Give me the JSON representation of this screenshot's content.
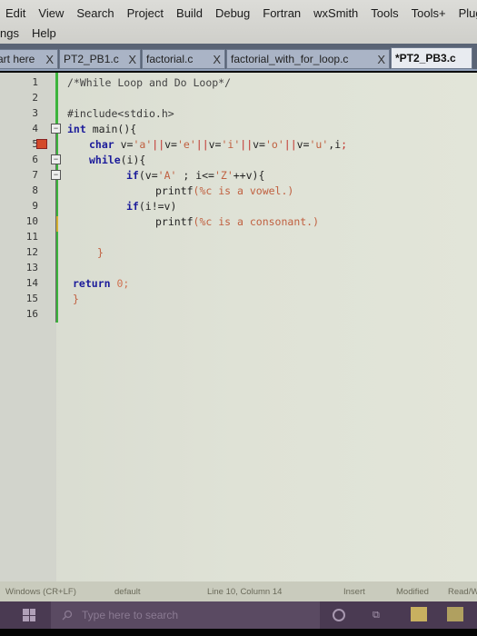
{
  "menu": {
    "row1": [
      "Edit",
      "View",
      "Search",
      "Project",
      "Build",
      "Debug",
      "Fortran",
      "wxSmith",
      "Tools",
      "Tools+",
      "Plugins"
    ],
    "row2": [
      "ngs",
      "Help"
    ]
  },
  "tabs": [
    {
      "label": "art here",
      "close": "X"
    },
    {
      "label": "PT2_PB1.c",
      "close": "X"
    },
    {
      "label": "factorial.c",
      "close": "X"
    },
    {
      "label": "factorial_with_for_loop.c",
      "close": "X"
    },
    {
      "label": "*PT2_PB3.c",
      "active": true
    }
  ],
  "editor": {
    "line_numbers": [
      "1",
      "2",
      "3",
      "4",
      "5",
      "6",
      "7",
      "8",
      "9",
      "10",
      "11",
      "12",
      "13",
      "14",
      "15",
      "16"
    ],
    "code": {
      "l1": "/*While Loop and Do Loop*/",
      "l3": "#include<stdio.h>",
      "l4_kw": "int",
      "l4_rest": " main(){",
      "l5_kw": "char",
      "l5_a": " v=",
      "l5_b": "'a'",
      "l5_c": "||",
      "l5_d": "v=",
      "l5_e": "'e'",
      "l5_f": "||",
      "l5_g": "v=",
      "l5_h": "'i'",
      "l5_i": "||",
      "l5_j": "v=",
      "l5_k": "'o'",
      "l5_l": "||",
      "l5_m": "v=",
      "l5_n": "'u'",
      "l5_o": ",i",
      "l5_p": ";",
      "l6_kw": "while",
      "l6_rest": "(i){",
      "l7_kw": "if",
      "l7_a": "(v=",
      "l7_b": "'A'",
      "l7_c": " ; i<=",
      "l7_d": "'Z'",
      "l7_e": "++v){",
      "l8_a": "printf",
      "l8_b": "(%c is a vowel.)",
      "l9_kw": "if",
      "l9_rest": "(i!=v)",
      "l10_a": "printf",
      "l10_b": "(%c is a consonant.)",
      "l12": "}",
      "l14_kw": "return",
      "l14_num": " 0;",
      "l15": "}"
    }
  },
  "status": {
    "eol": "Windows (CR+LF)",
    "encoding": "default",
    "position": "Line 10, Column 14",
    "mode": "Insert",
    "modified": "Modified",
    "access": "Read/W"
  },
  "taskbar": {
    "search_placeholder": "Type here to search"
  }
}
